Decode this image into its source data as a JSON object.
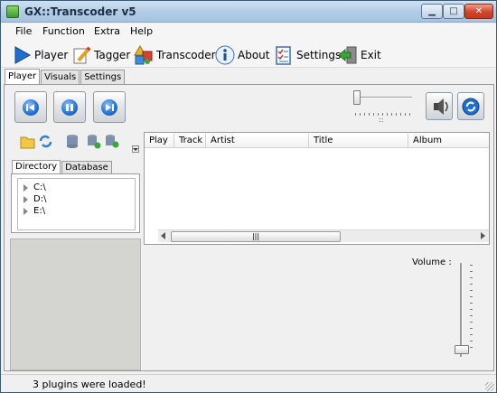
{
  "window": {
    "title": "GX::Transcoder v5"
  },
  "menu": [
    "File",
    "Function",
    "Extra",
    "Help"
  ],
  "toolbar": [
    {
      "label": "Player",
      "icon": "play-icon"
    },
    {
      "label": "Tagger",
      "icon": "tagger-pencil-icon"
    },
    {
      "label": "Transcoder",
      "icon": "transcoder-shapes-icon"
    },
    {
      "label": "About",
      "icon": "info-icon"
    },
    {
      "label": "Settings",
      "icon": "settings-checklist-icon"
    },
    {
      "label": "Exit",
      "icon": "exit-door-icon"
    }
  ],
  "tabs": [
    "Player",
    "Visuals",
    "Settings"
  ],
  "seek": {
    "tick_label": "::"
  },
  "directory_tabs": [
    "Directory",
    "Database"
  ],
  "drives": [
    "C:\\",
    "D:\\",
    "E:\\"
  ],
  "playlist": {
    "columns": [
      "Play",
      "Track",
      "Artist",
      "Title",
      "Album"
    ],
    "scroll_grip": "|||"
  },
  "volume": {
    "label": "Volume :"
  },
  "status": {
    "text": "3 plugins were loaded!"
  },
  "colors": {
    "accent_blue": "#1f6fd2",
    "window_bg": "#f0f0f0"
  }
}
